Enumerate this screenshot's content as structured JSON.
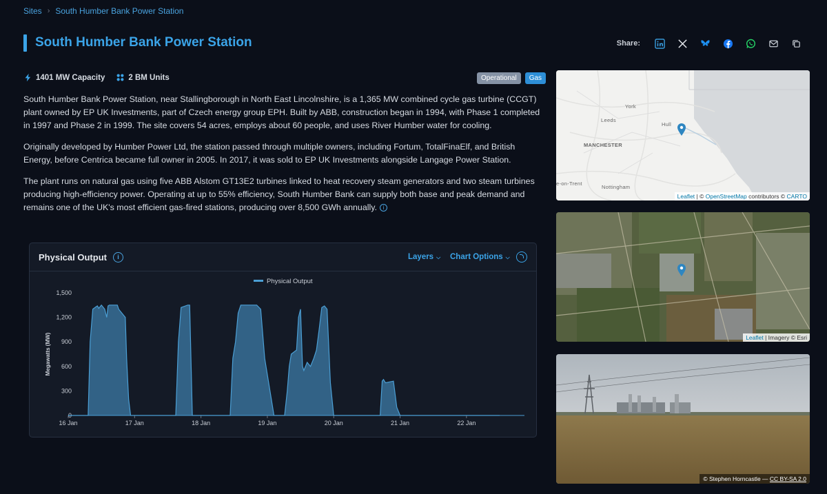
{
  "breadcrumb": {
    "root": "Sites",
    "current": "South Humber Bank Power Station"
  },
  "page": {
    "title": "South Humber Bank Power Station"
  },
  "share": {
    "label": "Share:",
    "icons": [
      "linkedin-icon",
      "x-icon",
      "bluesky-icon",
      "facebook-icon",
      "whatsapp-icon",
      "email-icon",
      "copy-icon"
    ]
  },
  "facts": {
    "capacity": "1401 MW Capacity",
    "units": "2 BM Units"
  },
  "badges": {
    "status": "Operational",
    "fuel": "Gas"
  },
  "description": [
    "South Humber Bank Power Station, near Stallingborough in North East Lincolnshire, is a 1,365 MW combined cycle gas turbine (CCGT) plant owned by EP UK Investments, part of Czech energy group EPH. Built by ABB, construction began in 1994, with Phase 1 completed in 1997 and Phase 2 in 1999. The site covers 54 acres, employs about 60 people, and uses River Humber water for cooling.",
    "Originally developed by Humber Power Ltd, the station passed through multiple owners, including Fortum, TotalFinaElf, and British Energy, before Centrica became full owner in 2005. In 2017, it was sold to EP UK Investments alongside Langage Power Station.",
    "The plant runs on natural gas using five ABB Alstom GT13E2 turbines linked to heat recovery steam generators and two steam turbines producing high-efficiency power. Operating at up to 55% efficiency, South Humber Bank can supply both base and peak demand and remains one of the UK's most efficient gas-fired stations, producing over 8,500 GWh annually."
  ],
  "chart_card": {
    "title": "Physical Output",
    "layers_label": "Layers",
    "options_label": "Chart Options"
  },
  "chart_data": {
    "type": "area",
    "ylabel": "Megawatts (MW)",
    "ylim": [
      0,
      1500
    ],
    "yticks": [
      0,
      300,
      600,
      900,
      1200,
      1500
    ],
    "ytick_labels": [
      "0",
      "300",
      "600",
      "900",
      "1,200",
      "1,500"
    ],
    "xlim": [
      0,
      6.5
    ],
    "xticks": [
      0,
      1,
      2,
      3,
      4,
      5,
      6
    ],
    "xtick_labels": [
      "16 Jan",
      "17 Jan",
      "18 Jan",
      "19 Jan",
      "20 Jan",
      "21 Jan",
      "22 Jan"
    ],
    "series": [
      {
        "name": "Physical Output",
        "color": "#4b9fd5",
        "x": [
          0,
          0.3,
          0.33,
          0.37,
          0.42,
          0.44,
          0.46,
          0.5,
          0.55,
          0.58,
          0.6,
          0.62,
          0.66,
          0.7,
          0.74,
          0.76,
          0.86,
          0.88,
          0.91,
          0.94,
          1.0,
          1.5,
          1.62,
          1.66,
          1.7,
          1.8,
          1.83,
          1.87,
          2.2,
          2.44,
          2.48,
          2.52,
          2.56,
          2.6,
          2.8,
          2.84,
          2.9,
          2.96,
          3.1,
          3.26,
          3.3,
          3.33,
          3.36,
          3.44,
          3.47,
          3.5,
          3.53,
          3.55,
          3.6,
          3.65,
          3.7,
          3.74,
          3.78,
          3.82,
          3.86,
          3.9,
          3.95,
          4.0,
          4.3,
          4.7,
          4.73,
          4.75,
          4.78,
          4.9,
          4.95,
          5.0,
          6.5
        ],
        "values": [
          0,
          0,
          900,
          1300,
          1330,
          1340,
          1310,
          1350,
          1300,
          1200,
          1340,
          1350,
          1350,
          1350,
          1350,
          1300,
          1200,
          700,
          200,
          0,
          0,
          0,
          0,
          900,
          1320,
          1350,
          1350,
          0,
          0,
          0,
          700,
          900,
          1250,
          1350,
          1350,
          1350,
          1300,
          700,
          0,
          0,
          300,
          600,
          750,
          800,
          1200,
          1300,
          600,
          550,
          650,
          600,
          700,
          800,
          1050,
          1320,
          1340,
          1300,
          400,
          0,
          0,
          0,
          420,
          440,
          400,
          420,
          100,
          0,
          0
        ]
      }
    ],
    "legend": "top-center",
    "grid": false
  },
  "map": {
    "attribution_leaflet": "Leaflet",
    "attribution_osm": "OpenStreetMap",
    "attribution_contributors": "contributors ©",
    "attribution_carto": "CARTO",
    "cities": [
      "York",
      "Leeds",
      "Hull",
      "MANCHESTER",
      "e-on-Trent",
      "Nottingham"
    ]
  },
  "satellite": {
    "attribution_leaflet": "Leaflet",
    "attribution_imagery": "| Imagery © Esri"
  },
  "photo": {
    "credit": "© Stephen Horncastle —",
    "license": "CC BY-SA 2.0"
  }
}
